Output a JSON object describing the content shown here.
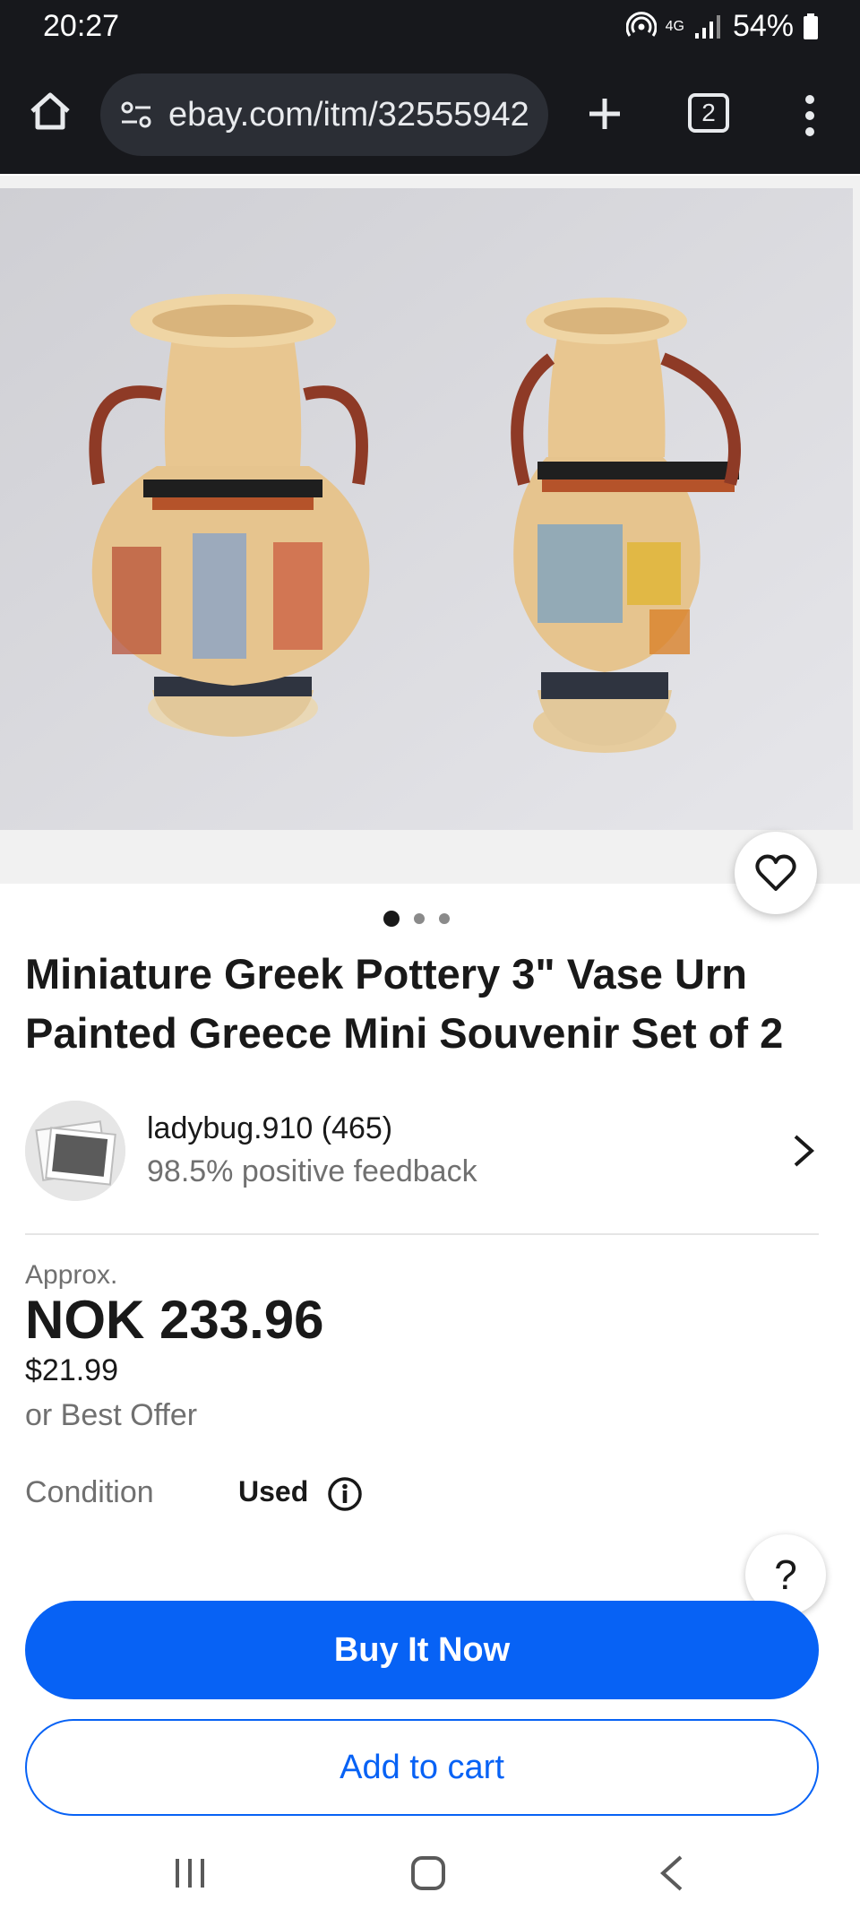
{
  "status_bar": {
    "time": "20:27",
    "network": "4G",
    "battery": "54%",
    "icons": [
      "hotspot-icon",
      "signal-icon",
      "battery-icon"
    ]
  },
  "browser": {
    "url": "ebay.com/itm/32555942",
    "tab_count": "2",
    "icons": [
      "home-icon",
      "site-settings-icon",
      "plus-icon",
      "more-icon"
    ]
  },
  "gallery": {
    "image_count": 3,
    "active_index": 0,
    "favorite_icon": "heart-icon"
  },
  "listing": {
    "title": "Miniature Greek Pottery 3\" Vase Urn Painted Greece Mini Souvenir Set of 2"
  },
  "seller": {
    "name": "ladybug.910 (465)",
    "feedback": "98.5% positive feedback"
  },
  "price": {
    "approx_label": "Approx.",
    "local": "NOK 233.96",
    "usd": "$21.99",
    "offer": "or Best Offer"
  },
  "condition": {
    "label": "Condition",
    "value": "Used"
  },
  "help": {
    "label": "?"
  },
  "actions": {
    "buy_now": "Buy It Now",
    "add_to_cart": "Add to cart"
  },
  "colors": {
    "primary_blue": "#0762f5",
    "browser_bar": "#17181c"
  }
}
